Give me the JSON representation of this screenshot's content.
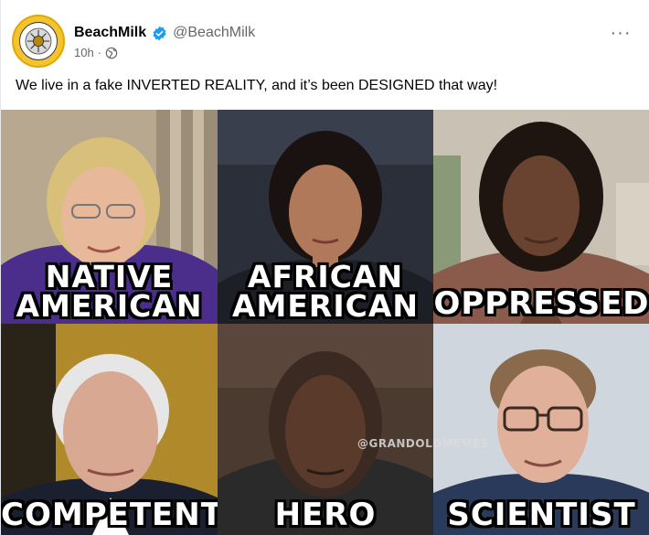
{
  "post": {
    "author": {
      "display_name": "BeachMilk",
      "handle": "@BeachMilk",
      "verified": true
    },
    "time": "10h",
    "separator": "·",
    "audience_icon": "globe-audience-icon",
    "more_icon": "more-options-icon",
    "more_label": "···",
    "caption": "We live in a fake INVERTED REALITY, and it’s been DESIGNED that way!"
  },
  "meme": {
    "watermark": "@GRANDOLDMEMES",
    "panels": [
      {
        "line1": "NATIVE",
        "line2": "AMERICAN"
      },
      {
        "line1": "AFRICAN",
        "line2": "AMERICAN"
      },
      {
        "line1": "OPPRESSED"
      },
      {
        "line1": "COMPETENT"
      },
      {
        "line1": "HERO"
      },
      {
        "line1": "SCIENTIST"
      }
    ]
  },
  "colors": {
    "text_primary": "#050505",
    "text_secondary": "#65676b",
    "verified_blue": "#1d9bf0",
    "avatar_gold": "#f4c430"
  }
}
